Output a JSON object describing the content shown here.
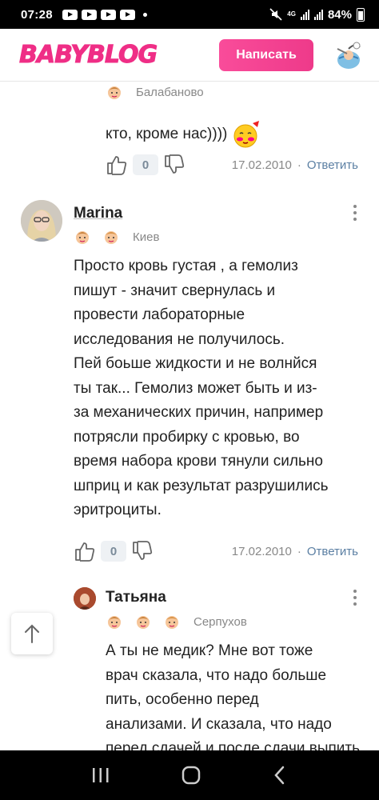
{
  "status_bar": {
    "time": "07:28",
    "battery": "84%",
    "network": "4G"
  },
  "header": {
    "logo": "BABYBLOG",
    "write_button": "Написать"
  },
  "comments": [
    {
      "location": "Балабаново",
      "text": "кто, кроме нас))))",
      "likes": "0",
      "date": "17.02.2010",
      "reply_label": "Ответить"
    },
    {
      "author": "Marina",
      "location": "Киев",
      "text_lines": [
        "Просто кровь густая , а гемолиз",
        "пишут - значит свернулась и",
        "провести лабораторные",
        "исследования не получилось.",
        "Пей боьше жидкости и не волнйся",
        "ты так... Гемолиз может быть и из-",
        "за механических причин, например",
        "потрясли пробирку с кровью, во",
        "время набора крови тянули сильно",
        "шприц и как результат разрушились",
        "эритроциты."
      ],
      "likes": "0",
      "date": "17.02.2010",
      "reply_label": "Ответить"
    },
    {
      "author": "Татьяна",
      "location": "Серпухов",
      "text_lines": [
        "А ты не медик? Мне вот тоже",
        "врач сказала, что надо больше",
        "пить, особенно перед",
        "анализами. И сказала, что надо",
        "перед сдачей и после сдачи выпить"
      ]
    }
  ],
  "icons": {
    "like": "thumbs-up-icon",
    "dislike": "thumbs-down-icon",
    "more": "more-vertical-icon",
    "scroll_up": "arrow-up-icon",
    "child_girl": "girl-icon",
    "child_boy": "boy-icon"
  },
  "colors": {
    "brand": "#ef2e86",
    "reply": "#5b7fa3",
    "muted": "#888888"
  }
}
